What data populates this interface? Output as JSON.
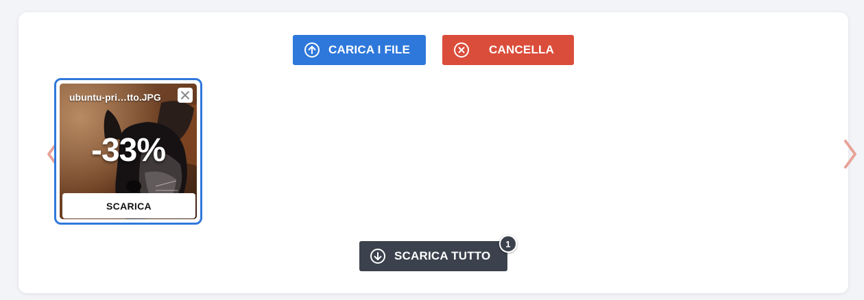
{
  "toolbar": {
    "upload_label": "CARICA I FILE",
    "clear_label": "CANCELLA",
    "download_all_label": "SCARICA TUTTO",
    "download_count": "1"
  },
  "files": [
    {
      "name": "ubuntu-pri…tto.JPG",
      "reduction": "-33%",
      "download_label": "SCARICA"
    }
  ],
  "colors": {
    "upload": "#2f78db",
    "clear": "#db4d3b",
    "download_all": "#3b424d",
    "arrow": "#e8a197",
    "card_border": "#2f78db"
  },
  "icons": {
    "upload": "arrow-up-circle-icon",
    "clear": "x-circle-icon",
    "download_all": "arrow-down-circle-icon",
    "remove": "close-icon",
    "prev": "chevron-left-icon",
    "next": "chevron-right-icon"
  }
}
